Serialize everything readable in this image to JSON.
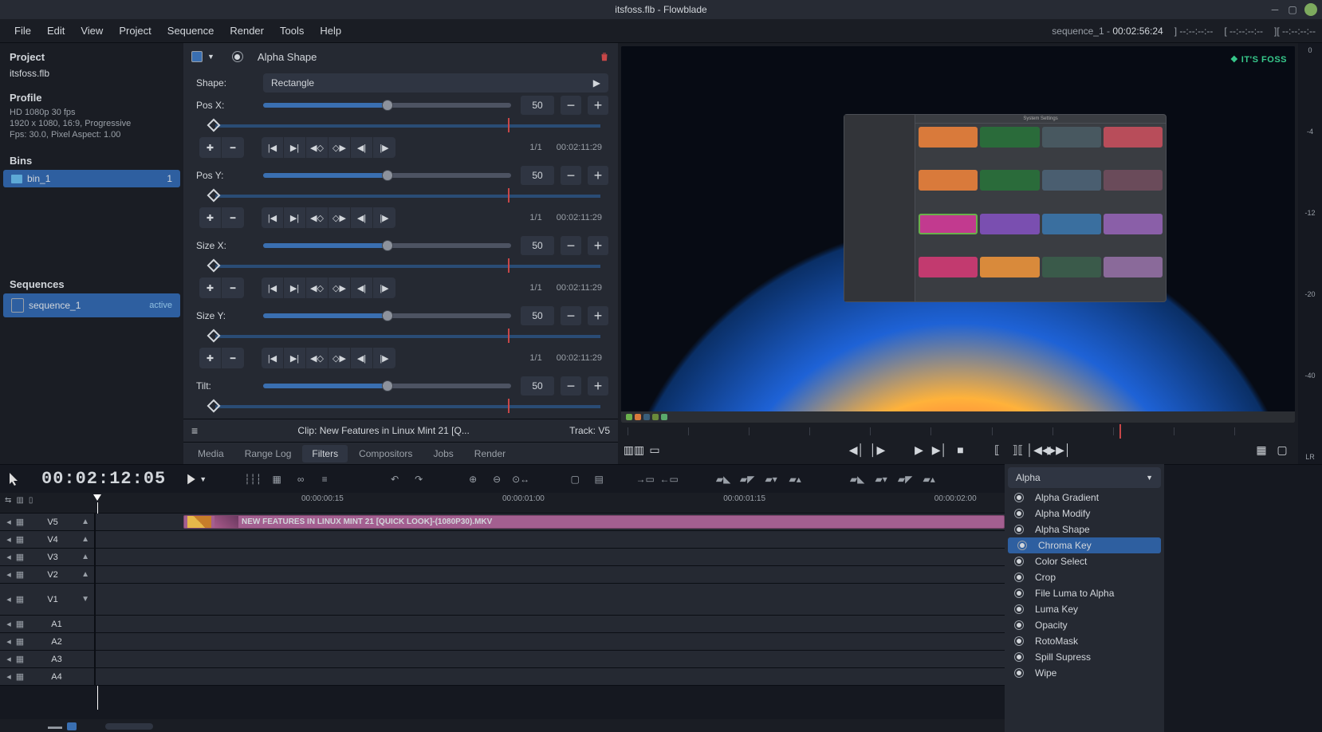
{
  "window_title": "itsfoss.flb - Flowblade",
  "menubar": [
    "File",
    "Edit",
    "View",
    "Project",
    "Sequence",
    "Render",
    "Tools",
    "Help"
  ],
  "header_right": {
    "sequence_label": "sequence_1 - ",
    "sequence_tc": "00:02:56:24",
    "tc_a": "]  --:--:--:--",
    "tc_b": "[  --:--:--:--",
    "tc_c": "][  --:--:--:--"
  },
  "project": {
    "header": "Project",
    "filename": "itsfoss.flb",
    "profile_label": "Profile",
    "profile_lines": [
      "HD 1080p 30 fps",
      "1920 x 1080, 16:9, Progressive",
      "Fps: 30.0, Pixel Aspect: 1.00"
    ],
    "bins_label": "Bins",
    "bins": [
      {
        "name": "bin_1",
        "count": "1"
      }
    ],
    "sequences_label": "Sequences",
    "sequences": [
      {
        "name": "sequence_1",
        "status": "active"
      }
    ]
  },
  "filter": {
    "title": "Alpha Shape",
    "shape_label": "Shape:",
    "shape_value": "Rectangle",
    "params": [
      {
        "label": "Pos X:",
        "value": "50",
        "kf": "1/1",
        "tc": "00:02:11:29"
      },
      {
        "label": "Pos Y:",
        "value": "50",
        "kf": "1/1",
        "tc": "00:02:11:29"
      },
      {
        "label": "Size X:",
        "value": "50",
        "kf": "1/1",
        "tc": "00:02:11:29"
      },
      {
        "label": "Size Y:",
        "value": "50",
        "kf": "1/1",
        "tc": "00:02:11:29"
      },
      {
        "label": "Tilt:",
        "value": "50",
        "kf": "",
        "tc": ""
      }
    ]
  },
  "clip_footer": {
    "clip": "Clip: New Features in Linux Mint 21 [Q...",
    "track": "Track: V5"
  },
  "tabs": [
    "Media",
    "Range Log",
    "Filters",
    "Compositors",
    "Jobs",
    "Render"
  ],
  "active_tab": 2,
  "preview": {
    "logo": "❖ IT'S FOSS",
    "dialog_title": "System Settings",
    "vu_labels": [
      "0",
      "-4",
      "-12",
      "-20",
      "-40"
    ],
    "vu_lr": "LR"
  },
  "timeline_toolbar": {
    "timecode": "00:02:12:05"
  },
  "ruler_labels": [
    {
      "pos": "30%",
      "text": "00:00:00:15"
    },
    {
      "pos": "50%",
      "text": "00:00:01:00"
    },
    {
      "pos": "72%",
      "text": "00:00:01:15"
    },
    {
      "pos": "93%",
      "text": "00:00:02:00"
    }
  ],
  "tracks": {
    "video": [
      "V5",
      "V4",
      "V3",
      "V2",
      "V1"
    ],
    "audio": [
      "A1",
      "A2",
      "A3",
      "A4"
    ]
  },
  "clip_name": "NEW FEATURES IN LINUX MINT 21 [QUICK LOOK]-(1080P30).MKV",
  "filters_panel": {
    "category": "Alpha",
    "items": [
      "Alpha Gradient",
      "Alpha Modify",
      "Alpha Shape",
      "Chroma Key",
      "Color Select",
      "Crop",
      "File Luma to Alpha",
      "Luma Key",
      "Opacity",
      "RotoMask",
      "Spill Supress",
      "Wipe"
    ],
    "selected": 3
  }
}
